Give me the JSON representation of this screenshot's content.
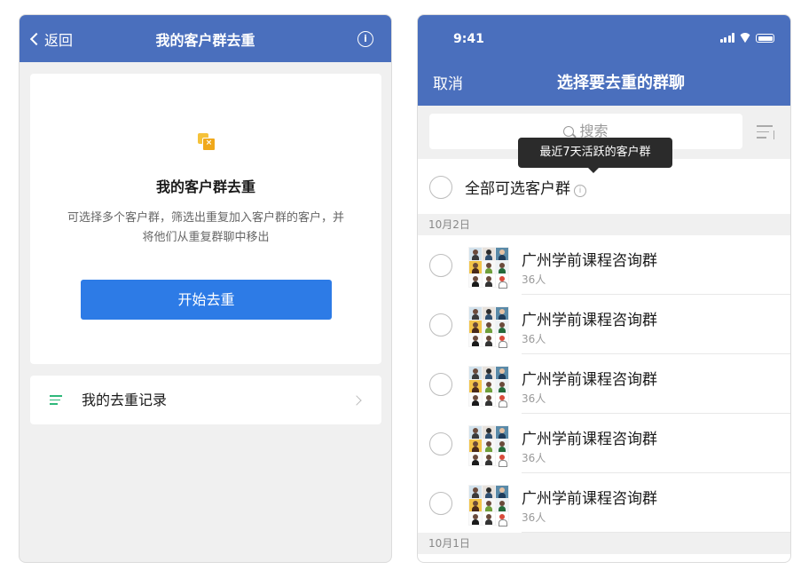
{
  "left": {
    "header": {
      "back_label": "返回",
      "title": "我的客户群去重",
      "info_glyph": "i"
    },
    "card": {
      "icon": "dedupe-groups-icon",
      "icon_glyph": "×",
      "title": "我的客户群去重",
      "description": "可选择多个客户群，筛选出重复加入客户群的客户，并将他们从重复群聊中移出",
      "button_label": "开始去重"
    },
    "record": {
      "label": "我的去重记录"
    }
  },
  "right": {
    "status_bar": {
      "time": "9:41"
    },
    "nav": {
      "cancel_label": "取消",
      "title": "选择要去重的群聊"
    },
    "search": {
      "placeholder": "搜索"
    },
    "tooltip": "最近7天活跃的客户群",
    "select_all": {
      "label": "全部可选客户群",
      "info_glyph": "i"
    },
    "sections": [
      {
        "date": "10月2日",
        "groups": [
          {
            "name": "广州学前课程咨询群",
            "count": "36人"
          },
          {
            "name": "广州学前课程咨询群",
            "count": "36人"
          },
          {
            "name": "广州学前课程咨询群",
            "count": "36人"
          },
          {
            "name": "广州学前课程咨询群",
            "count": "36人"
          },
          {
            "name": "广州学前课程咨询群",
            "count": "36人"
          }
        ]
      },
      {
        "date": "10月1日",
        "groups": []
      }
    ]
  },
  "colors": {
    "header_blue": "#4a6fbd",
    "primary_button": "#2d7be6",
    "list_icon_green": "#2eb87a",
    "icon_yellow": "#f0a81a",
    "tooltip_bg": "#2b2b2b"
  }
}
